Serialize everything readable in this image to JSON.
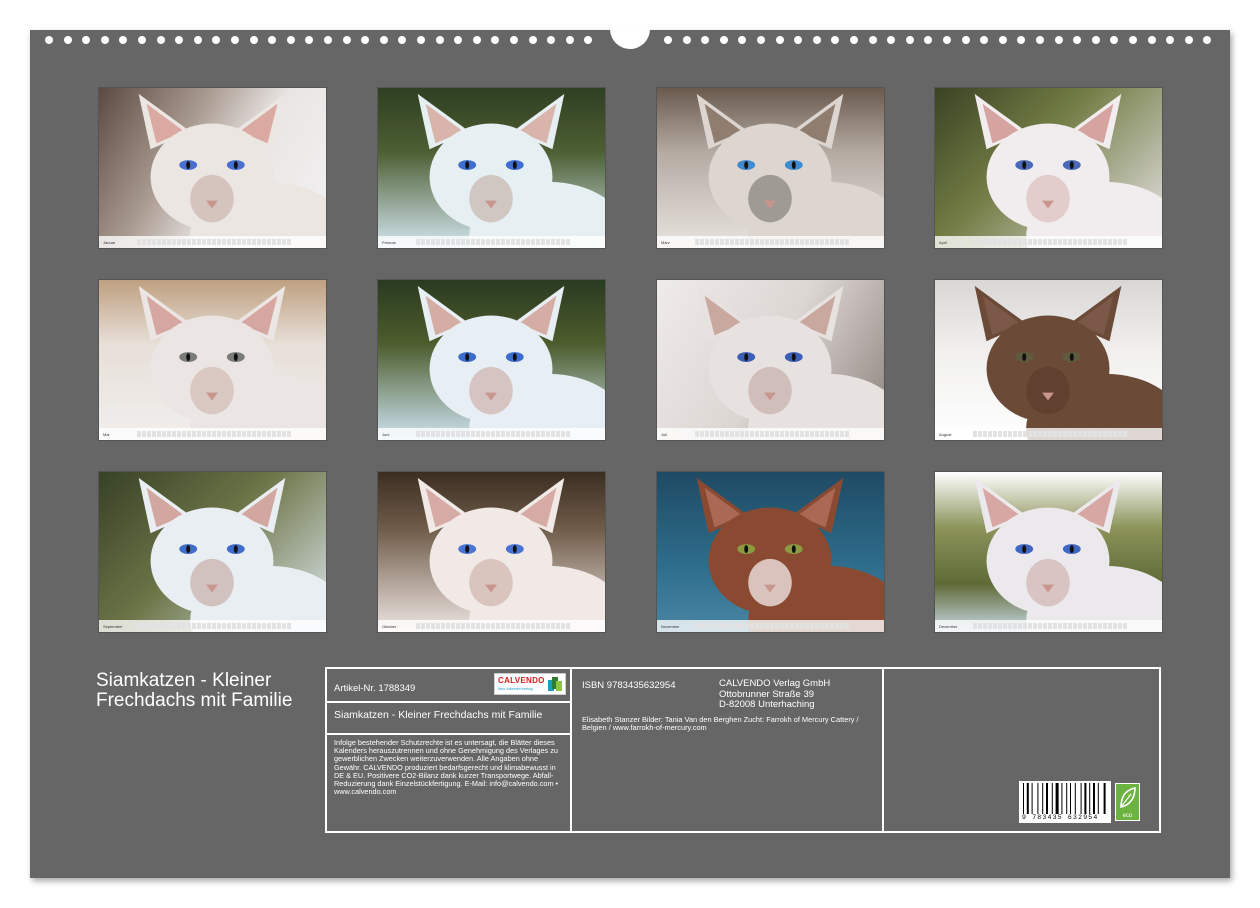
{
  "calendar": {
    "title": "Siamkatzen - Kleiner Frechdachs mit Familie",
    "months": [
      {
        "name": "Januar",
        "photo": "white-siamese-kitten-blue-eyes"
      },
      {
        "name": "Februar",
        "photo": "white-kitten-big-ears"
      },
      {
        "name": "März",
        "photo": "gray-point-siamese-portrait"
      },
      {
        "name": "April",
        "photo": "white-kitten-profile"
      },
      {
        "name": "Mai",
        "photo": "cats-cuddling"
      },
      {
        "name": "Juni",
        "photo": "white-kitten-hissing"
      },
      {
        "name": "Juli",
        "photo": "white-siamese-resting"
      },
      {
        "name": "August",
        "photo": "brown-kitten-stretching"
      },
      {
        "name": "September",
        "photo": "white-kitten-outdoors"
      },
      {
        "name": "Oktober",
        "photo": "white-cat-blue-eyes"
      },
      {
        "name": "November",
        "photo": "brown-white-kitten-green-eyes"
      },
      {
        "name": "Dezember",
        "photo": "white-kitten-open-mouth"
      }
    ]
  },
  "info": {
    "artikel": "Artikel-Nr. 1788349",
    "logo_word": "CALVENDO",
    "logo_tagline": "kein kalenderverlag",
    "product_title": "Siamkatzen - Kleiner Frechdachs mit Familie",
    "legal": "Infolge bestehender Schutzrechte ist es untersagt, die Blätter dieses Kalenders herauszutrennen und ohne Genehmigung des Verlages zu gewerblichen Zwecken weiterzuverwenden. Alle Angaben ohne Gewähr. CALVENDO produziert bedarfsgerecht und klimabewusst in DE & EU. Positivere CO2-Bilanz dank kurzer Transportwege. Abfall-Reduzierung dank Einzelstückfertigung. E-Mail: info@calvendo.com • www.calvendo.com",
    "isbn": "ISBN 9783435632954",
    "publisher_lines": [
      "CALVENDO Verlag GmbH",
      "Ottobrunner Straße 39",
      "D-82008 Unterhaching"
    ],
    "credits": "Elisabeth Stanzer Bilder: Tania Van den Berghen Zucht: Farrokh of Mercury Cattery / Belgien / www.farrokh-of-mercury.com",
    "barcode_number": "9 783435 632954",
    "eco_label": "eco"
  },
  "colors": {
    "sheet": "#666666",
    "logo_red": "#d21e1e",
    "eco_green": "#6cb33f"
  }
}
